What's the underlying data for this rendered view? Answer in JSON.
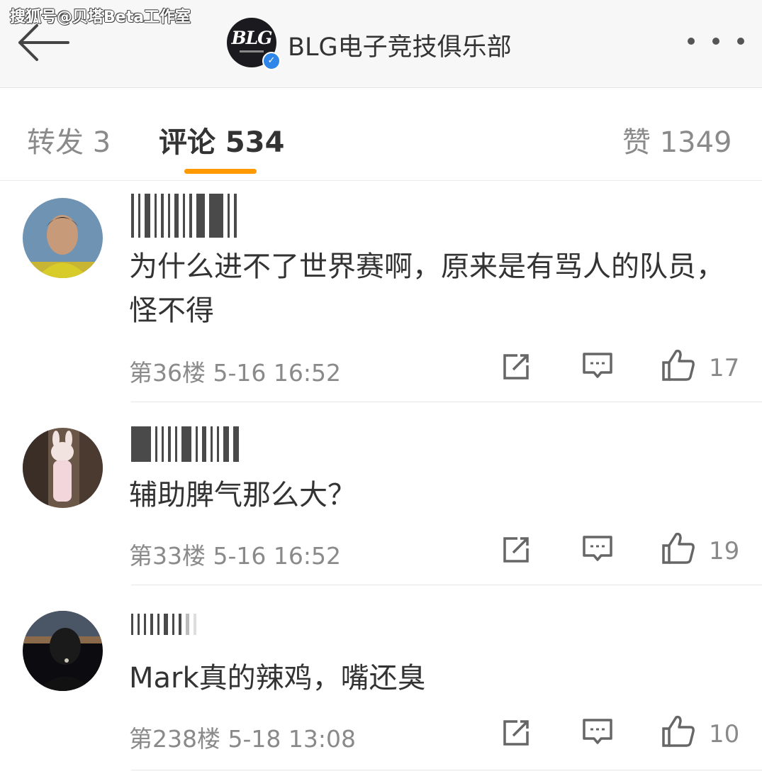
{
  "watermark": "搜狐号@贝塔Beta工作室",
  "header": {
    "title": "BLG电子竞技俱乐部",
    "logo_text": "BLG"
  },
  "tabs": {
    "repost": "转发 3",
    "comment": "评论 534",
    "like": "赞 1349"
  },
  "colors": {
    "accent": "#ff9900",
    "verified": "#2f86e8",
    "text": "#333333",
    "muted": "#8a8a8a"
  },
  "comments": [
    {
      "text": "为什么进不了世界赛啊，原来是有骂人的队员，怪不得",
      "floor": "第36楼",
      "time": "5-16 16:52",
      "likes": "17"
    },
    {
      "text": "辅助脾气那么大？",
      "floor": "第33楼",
      "time": "5-16 16:52",
      "likes": "19"
    },
    {
      "text": "Mark真的辣鸡，嘴还臭",
      "floor": "第238楼",
      "time": "5-18 13:08",
      "likes": "10"
    }
  ],
  "icons": [
    "back-arrow-icon",
    "more-icon",
    "verified-icon",
    "share-icon",
    "reply-icon",
    "thumbs-up-icon"
  ]
}
